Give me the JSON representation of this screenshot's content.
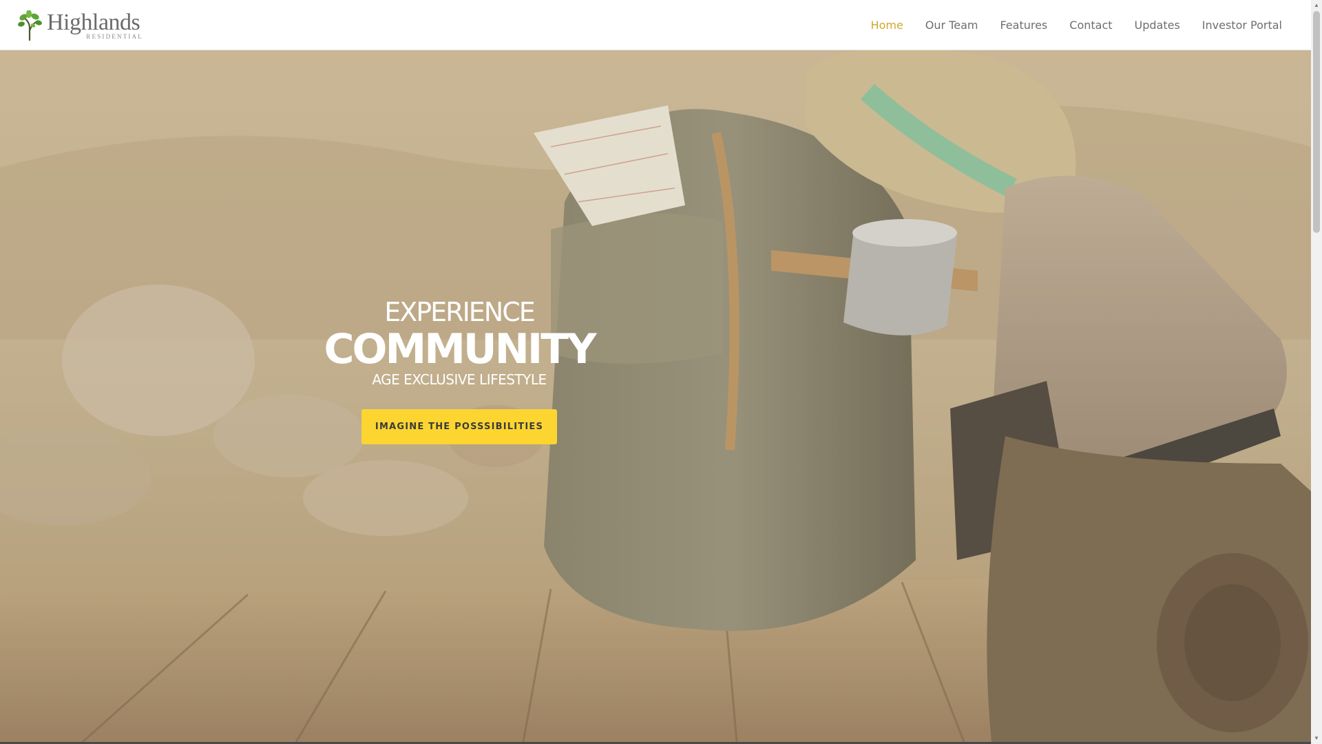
{
  "brand": {
    "name": "Highlands",
    "sub": "RESIDENTIAL",
    "logo_icon": "tree-icon"
  },
  "nav": {
    "items": [
      {
        "label": "Home",
        "active": true
      },
      {
        "label": "Our Team",
        "active": false
      },
      {
        "label": "Features",
        "active": false
      },
      {
        "label": "Contact",
        "active": false
      },
      {
        "label": "Updates",
        "active": false
      },
      {
        "label": "Investor Portal",
        "active": false
      }
    ]
  },
  "hero": {
    "line1": "EXPERIENCE",
    "line2": "COMMUNITY",
    "line3": "AGE EXCLUSIVE LIFESTYLE",
    "cta_label": "IMAGINE THE POSSSIBILITIES",
    "image_subject": "hiking-backpack-hat-boots-photo"
  },
  "colors": {
    "accent": "#d3a62b",
    "cta_bg": "#fcd530",
    "nav_text": "#6e6e6e",
    "header_bg": "#ffffff"
  }
}
